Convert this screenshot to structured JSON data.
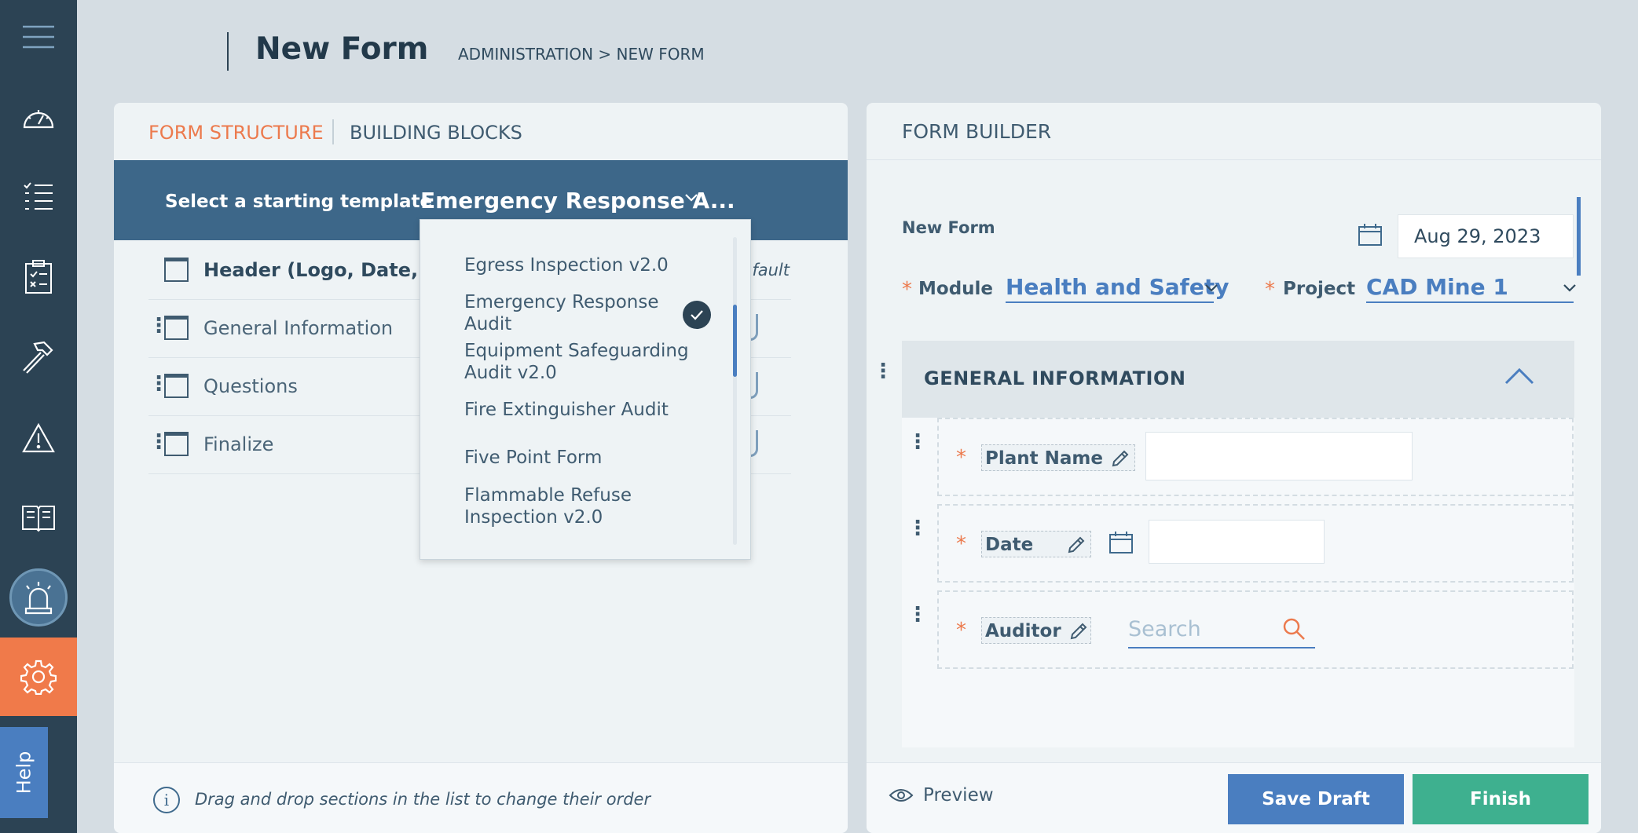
{
  "sidebar": {
    "items": [
      {
        "icon": "menu-icon"
      },
      {
        "icon": "dashboard-icon"
      },
      {
        "icon": "list-icon"
      },
      {
        "icon": "clipboard-icon"
      },
      {
        "icon": "hammer-icon"
      },
      {
        "icon": "warning-icon"
      },
      {
        "icon": "book-icon"
      },
      {
        "icon": "alarm-light-icon"
      },
      {
        "icon": "gear-icon"
      }
    ],
    "help_label": "Help",
    "active_color": "#f07a4a"
  },
  "header": {
    "title": "New Form",
    "breadcrumb": "ADMINISTRATION > NEW FORM"
  },
  "left_panel": {
    "tabs": [
      {
        "label": "FORM STRUCTURE",
        "active": true
      },
      {
        "label": "BUILDING BLOCKS",
        "active": false
      }
    ],
    "template_label": "Select a starting template",
    "template_value": "Emergency Response A...",
    "sections": [
      {
        "label": "Header (Logo, Date, Pro",
        "default_text": "fault"
      },
      {
        "label": "General Information"
      },
      {
        "label": "Questions"
      },
      {
        "label": "Finalize"
      }
    ],
    "info_text": "Drag and drop sections in the list to change their order"
  },
  "dropdown": {
    "options": [
      {
        "label": "Egress Inspection v2.0",
        "selected": false
      },
      {
        "label": "Emergency Response Audit",
        "selected": true
      },
      {
        "label": "Equipment Safeguarding Audit v2.0",
        "selected": false
      },
      {
        "label": "Fire Extinguisher Audit",
        "selected": false
      },
      {
        "label": "Five Point Form",
        "selected": false
      },
      {
        "label": "Flammable Refuse Inspection v2.0",
        "selected": false
      }
    ]
  },
  "right_panel": {
    "title": "FORM BUILDER",
    "form_name": "New Form",
    "date": "Aug 29, 2023",
    "required_marker": "*",
    "module_label": "Module",
    "module_value": "Health and Safety",
    "project_label": "Project",
    "project_value": "CAD Mine 1",
    "section_title": "GENERAL INFORMATION",
    "fields": [
      {
        "label": "Plant Name"
      },
      {
        "label": "Date"
      },
      {
        "label": "Auditor"
      }
    ],
    "search_placeholder": "Search",
    "preview_label": "Preview",
    "save_draft_label": "Save Draft",
    "finish_label": "Finish"
  },
  "colors": {
    "accent_orange": "#ec7a4d",
    "primary_blue": "#4a7ec0",
    "finish_green": "#3eb08f",
    "template_bar": "#3d6789",
    "sidebar_bg": "#2c4354"
  }
}
